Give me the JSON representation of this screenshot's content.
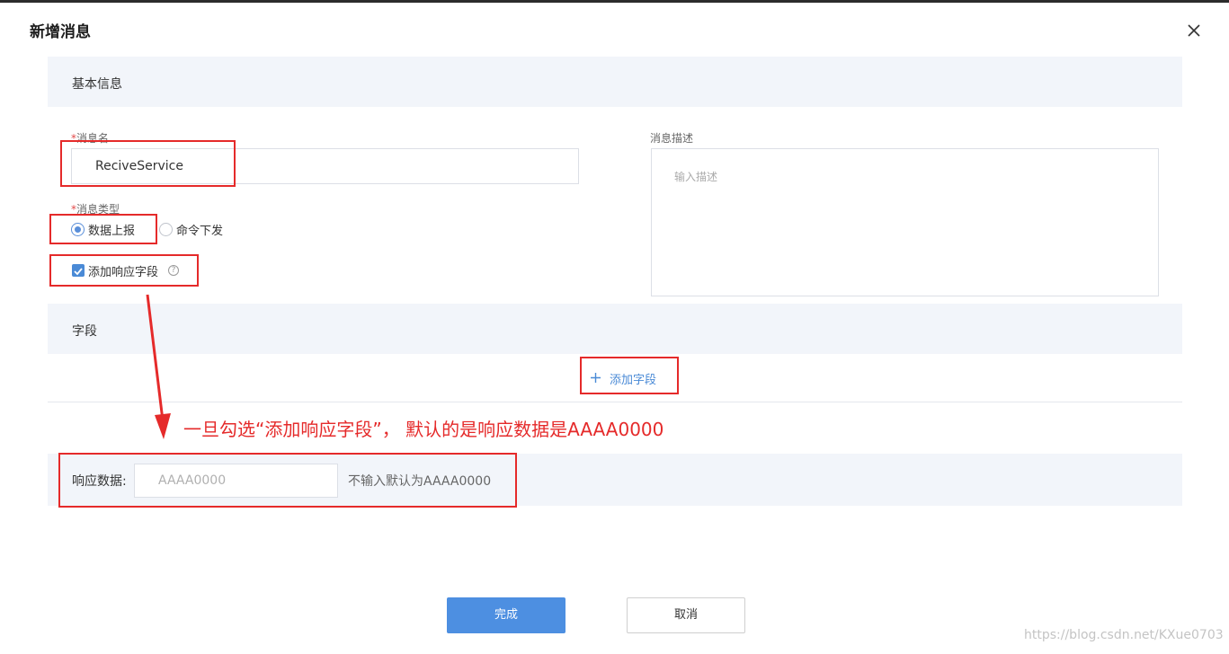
{
  "dialog": {
    "title": "新增消息",
    "close_icon": "close-icon"
  },
  "basic_info": {
    "section_title": "基本信息",
    "message_name": {
      "label": "消息名",
      "required_mark": "*",
      "value": "ReciveService"
    },
    "message_type": {
      "label": "消息类型",
      "required_mark": "*",
      "options": [
        {
          "label": "数据上报",
          "selected": true
        },
        {
          "label": "命令下发",
          "selected": false
        }
      ]
    },
    "add_response_field": {
      "label": "添加响应字段",
      "checked": true,
      "help_icon": "question-circle-icon",
      "help_glyph": "?"
    },
    "description": {
      "label": "消息描述",
      "placeholder": "输入描述"
    }
  },
  "fields": {
    "section_title": "字段",
    "add_button": {
      "icon": "plus-icon",
      "label": "添加字段"
    }
  },
  "annotation": {
    "text": "一旦勾选“添加响应字段”， 默认的是响应数据是AAAA0000",
    "color": "#e52a2a"
  },
  "response_data": {
    "label": "响应数据:",
    "placeholder": "AAAA0000",
    "hint": "不输入默认为AAAA0000"
  },
  "footer": {
    "confirm_label": "完成",
    "cancel_label": "取消",
    "confirm_color": "#4d8fe1"
  },
  "watermark": "https://blog.csdn.net/KXue0703"
}
